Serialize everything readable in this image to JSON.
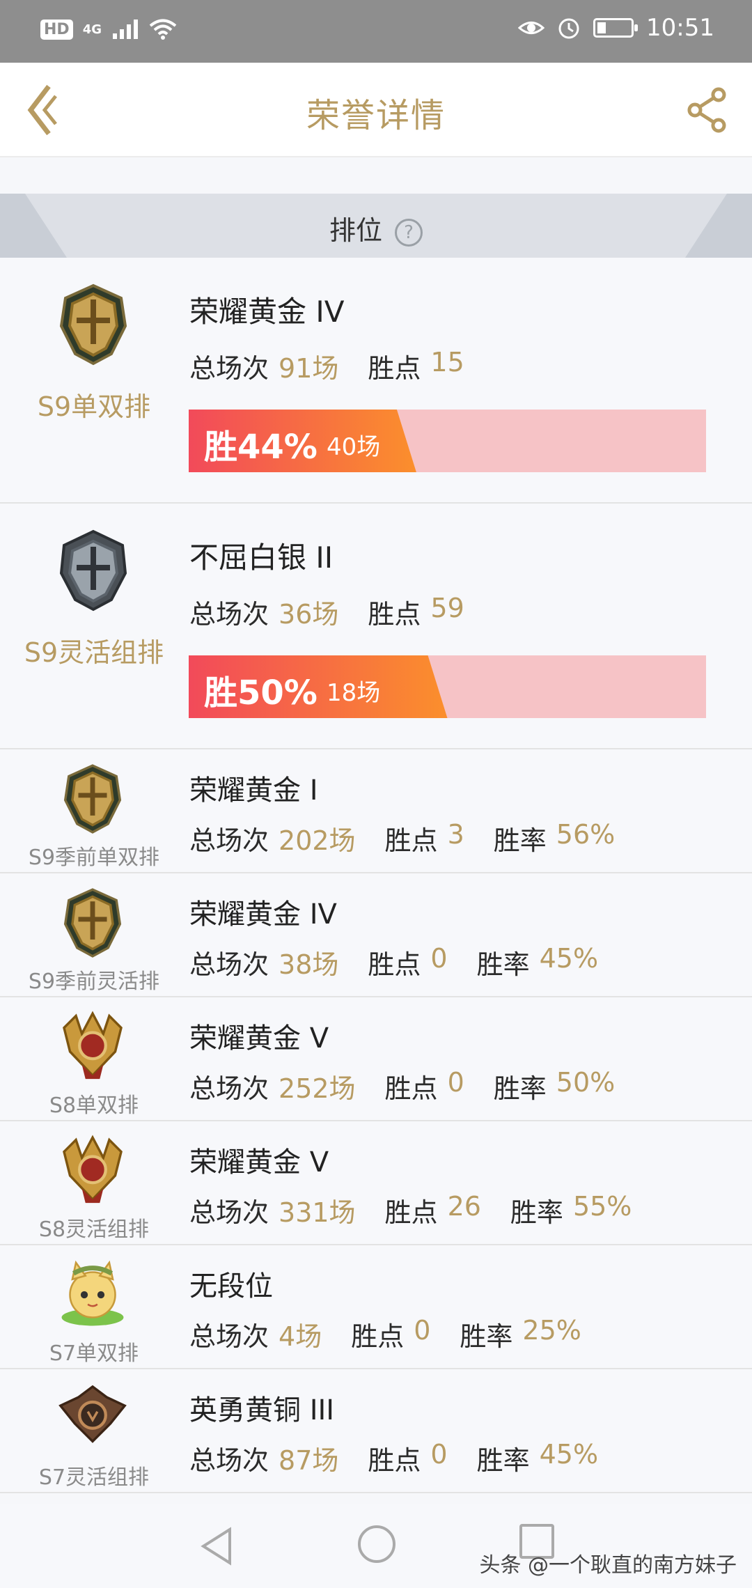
{
  "status_bar": {
    "network_badge": "HD",
    "network_type": "4G",
    "time": "10:51",
    "battery_level": 0.25
  },
  "header": {
    "title": "荣誉详情"
  },
  "section": {
    "title": "排位",
    "help_glyph": "?"
  },
  "labels": {
    "total_games": "总场次",
    "points": "胜点",
    "win_rate": "胜率"
  },
  "big_cards": [
    {
      "queue": "S9单双排",
      "rank": "荣耀黄金 IV",
      "total_games": "91场",
      "points": "15",
      "win_pct_text": "胜44%",
      "win_fraction": 0.44,
      "win_games": "40场",
      "emblem": "gold-helmet"
    },
    {
      "queue": "S9灵活组排",
      "rank": "不屈白银 II",
      "total_games": "36场",
      "points": "59",
      "win_pct_text": "胜50%",
      "win_fraction": 0.5,
      "win_games": "18场",
      "emblem": "silver-helmet"
    }
  ],
  "small_rows": [
    {
      "queue": "S9季前单双排",
      "rank": "荣耀黄金 I",
      "total_games": "202场",
      "points": "3",
      "win_rate": "56%",
      "emblem": "gold-helmet"
    },
    {
      "queue": "S9季前灵活排",
      "rank": "荣耀黄金 IV",
      "total_games": "38场",
      "points": "0",
      "win_rate": "45%",
      "emblem": "gold-helmet"
    },
    {
      "queue": "S8单双排",
      "rank": "荣耀黄金 V",
      "total_games": "252场",
      "points": "0",
      "win_rate": "50%",
      "emblem": "gold-crest"
    },
    {
      "queue": "S8灵活组排",
      "rank": "荣耀黄金 V",
      "total_games": "331场",
      "points": "26",
      "win_rate": "55%",
      "emblem": "gold-crest"
    },
    {
      "queue": "S7单双排",
      "rank": "无段位",
      "total_games": "4场",
      "points": "0",
      "win_rate": "25%",
      "emblem": "unranked-cat"
    },
    {
      "queue": "S7灵活组排",
      "rank": "英勇黄铜 III",
      "total_games": "87场",
      "points": "0",
      "win_rate": "45%",
      "emblem": "bronze-crest"
    }
  ],
  "watermark": "头条 @一个耿直的南方妹子",
  "colors": {
    "accent_gold": "#b79b62",
    "win_bar_start": "#f24a5a",
    "win_bar_end": "#fb8f2c",
    "win_bar_bg": "#f6c3c6"
  }
}
